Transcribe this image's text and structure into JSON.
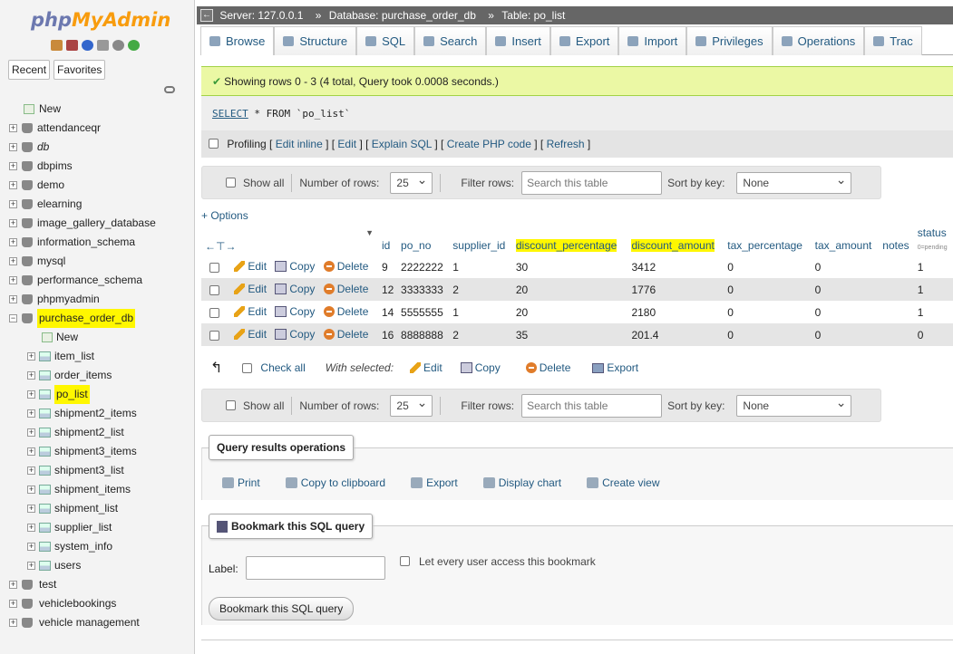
{
  "nav": {
    "logo_php": "php",
    "logo_myadmin": "MyAdmin",
    "tabs": [
      "Recent",
      "Favorites"
    ],
    "new_label": "New",
    "databases": [
      {
        "name": "attendanceqr"
      },
      {
        "name": "db",
        "italic": true
      },
      {
        "name": "dbpims"
      },
      {
        "name": "demo"
      },
      {
        "name": "elearning"
      },
      {
        "name": "image_gallery_database"
      },
      {
        "name": "information_schema"
      },
      {
        "name": "mysql"
      },
      {
        "name": "performance_schema"
      },
      {
        "name": "phpmyadmin"
      },
      {
        "name": "purchase_order_db",
        "expanded": true,
        "highlight": true
      }
    ],
    "db_children": [
      "New",
      "item_list",
      "order_items",
      "po_list",
      "shipment2_items",
      "shipment2_list",
      "shipment3_items",
      "shipment3_list",
      "shipment_items",
      "shipment_list",
      "supplier_list",
      "system_info",
      "users"
    ],
    "after": [
      "test",
      "vehiclebookings",
      "vehicle management"
    ]
  },
  "topbar": {
    "server": "Server: 127.0.0.1",
    "database": "Database: purchase_order_db",
    "table": "Table: po_list"
  },
  "tabs": [
    "Browse",
    "Structure",
    "SQL",
    "Search",
    "Insert",
    "Export",
    "Import",
    "Privileges",
    "Operations",
    "Trac"
  ],
  "success_msg": "Showing rows 0 - 3 (4 total, Query took 0.0008 seconds.)",
  "sql": {
    "select": "SELECT",
    "rest": " * FROM `po_list`"
  },
  "profiling": {
    "label": "Profiling",
    "links": [
      "Edit inline",
      "Edit",
      "Explain SQL",
      "Create PHP code",
      "Refresh"
    ]
  },
  "navbar": {
    "show_all": "Show all",
    "num_rows_label": "Number of rows:",
    "num_rows": "25",
    "filter_label": "Filter rows:",
    "filter_placeholder": "Search this table",
    "sort_label": "Sort by key:",
    "sort_value": "None"
  },
  "options_label": "+ Options",
  "table": {
    "columns": [
      "id",
      "po_no",
      "supplier_id",
      "discount_percentage",
      "discount_amount",
      "tax_percentage",
      "tax_amount",
      "notes",
      "status"
    ],
    "status_sub": "0=pending",
    "actions": {
      "edit": "Edit",
      "copy": "Copy",
      "delete": "Delete"
    },
    "rows": [
      [
        "9",
        "2222222",
        "1",
        "30",
        "3412",
        "0",
        "0",
        "",
        "1"
      ],
      [
        "12",
        "3333333",
        "2",
        "20",
        "1776",
        "0",
        "0",
        "",
        "1"
      ],
      [
        "14",
        "5555555",
        "1",
        "20",
        "2180",
        "0",
        "0",
        "",
        "1"
      ],
      [
        "16",
        "8888888",
        "2",
        "35",
        "201.4",
        "0",
        "0",
        "",
        "0"
      ]
    ]
  },
  "with_selected": {
    "check_all": "Check all",
    "label": "With selected:",
    "edit": "Edit",
    "copy": "Copy",
    "delete": "Delete",
    "export": "Export"
  },
  "qro": {
    "legend": "Query results operations",
    "items": [
      "Print",
      "Copy to clipboard",
      "Export",
      "Display chart",
      "Create view"
    ]
  },
  "bookmark": {
    "legend": "Bookmark this SQL query",
    "label": "Label:",
    "share": "Let every user access this bookmark",
    "button": "Bookmark this SQL query"
  }
}
